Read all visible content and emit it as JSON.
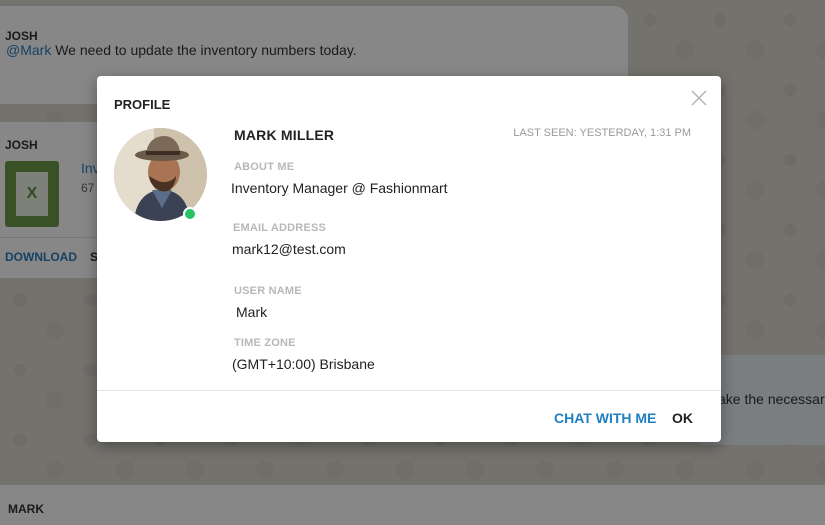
{
  "background": {
    "message1": {
      "sender": "JOSH",
      "mention": "@Mark",
      "text": " We need to update the inventory numbers today."
    },
    "message2": {
      "sender": "JOSH",
      "file_name": "Inv",
      "file_size": "67",
      "file_icon_letter": "X",
      "download_label": "DOWNLOAD",
      "share_label": "S"
    },
    "message3": {
      "text": "ake the necessar"
    },
    "message4": {
      "sender": "MARK"
    }
  },
  "dialog": {
    "title": "PROFILE",
    "name": "MARK MILLER",
    "last_seen": "LAST SEEN: YESTERDAY, 1:31 PM",
    "about_label": "ABOUT ME",
    "about_value": "Inventory Manager @ Fashionmart",
    "email_label": "EMAIL ADDRESS",
    "email_value": "mark12@test.com",
    "username_label": "USER NAME",
    "username_value": "Mark",
    "timezone_label": "TIME ZONE",
    "timezone_value": "(GMT+10:00) Brisbane",
    "status": "online",
    "chat_button": "CHAT WITH ME",
    "ok_button": "OK"
  },
  "colors": {
    "accent": "#1f80c3",
    "online": "#27c466",
    "label": "#b8b8b8"
  },
  "icons": [
    "close-icon",
    "excel-file-icon",
    "user-avatar"
  ]
}
